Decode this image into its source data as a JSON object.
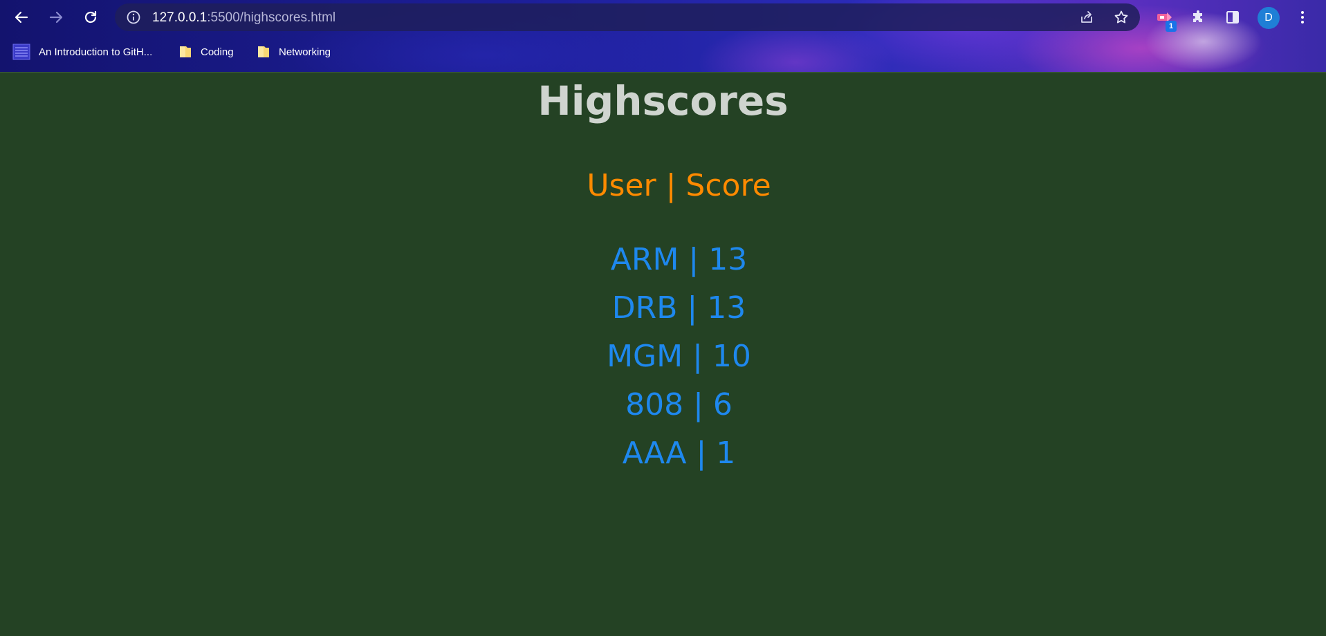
{
  "browser": {
    "url_host": "127.0.0.1",
    "url_rest": ":5500/highscores.html",
    "profile_initial": "D",
    "extension_badge": "1",
    "bookmarks": [
      {
        "label": "An Introduction to GitH...",
        "icon": "github-course-icon"
      },
      {
        "label": "Coding",
        "icon": "folder-icon"
      },
      {
        "label": "Networking",
        "icon": "folder-icon"
      }
    ]
  },
  "page": {
    "title": "Highscores",
    "header": "User | Score",
    "scores": [
      {
        "text": "ARM | 13"
      },
      {
        "text": "DRB | 13"
      },
      {
        "text": "MGM | 10"
      },
      {
        "text": "808 | 6"
      },
      {
        "text": "AAA | 1"
      }
    ]
  },
  "colors": {
    "page_background": "#244224",
    "title": "#cfd4cf",
    "header": "#ff8a00",
    "score": "#1e88ee"
  }
}
